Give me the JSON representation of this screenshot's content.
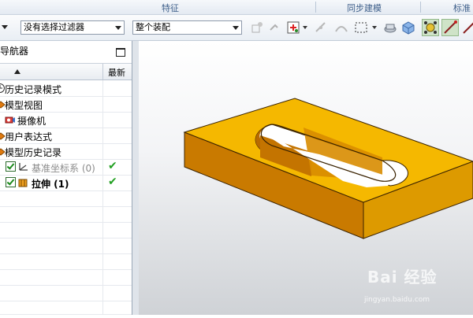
{
  "ribbon": {
    "group_labels": [
      "特征",
      "同步建模",
      "标准"
    ]
  },
  "toolbar": {
    "filter_combo": "没有选择过滤器",
    "assembly_combo": "整个装配"
  },
  "navigator": {
    "title": "导航器",
    "column_latest": "最新",
    "rows": [
      {
        "label": "历史记录模式"
      },
      {
        "label": "模型视图"
      },
      {
        "label": "摄像机"
      },
      {
        "label": "用户表达式"
      },
      {
        "label": "模型历史记录"
      },
      {
        "label": "基准坐标系 (0)"
      },
      {
        "label": "拉伸 (1)"
      }
    ]
  },
  "watermark": {
    "brand": "Bai 经验",
    "url": "jingyan.baidu.com"
  },
  "colors": {
    "part_top": "#f5b800",
    "part_front": "#c97a00",
    "part_side": "#dd9a00",
    "check_green": "#22a022"
  }
}
